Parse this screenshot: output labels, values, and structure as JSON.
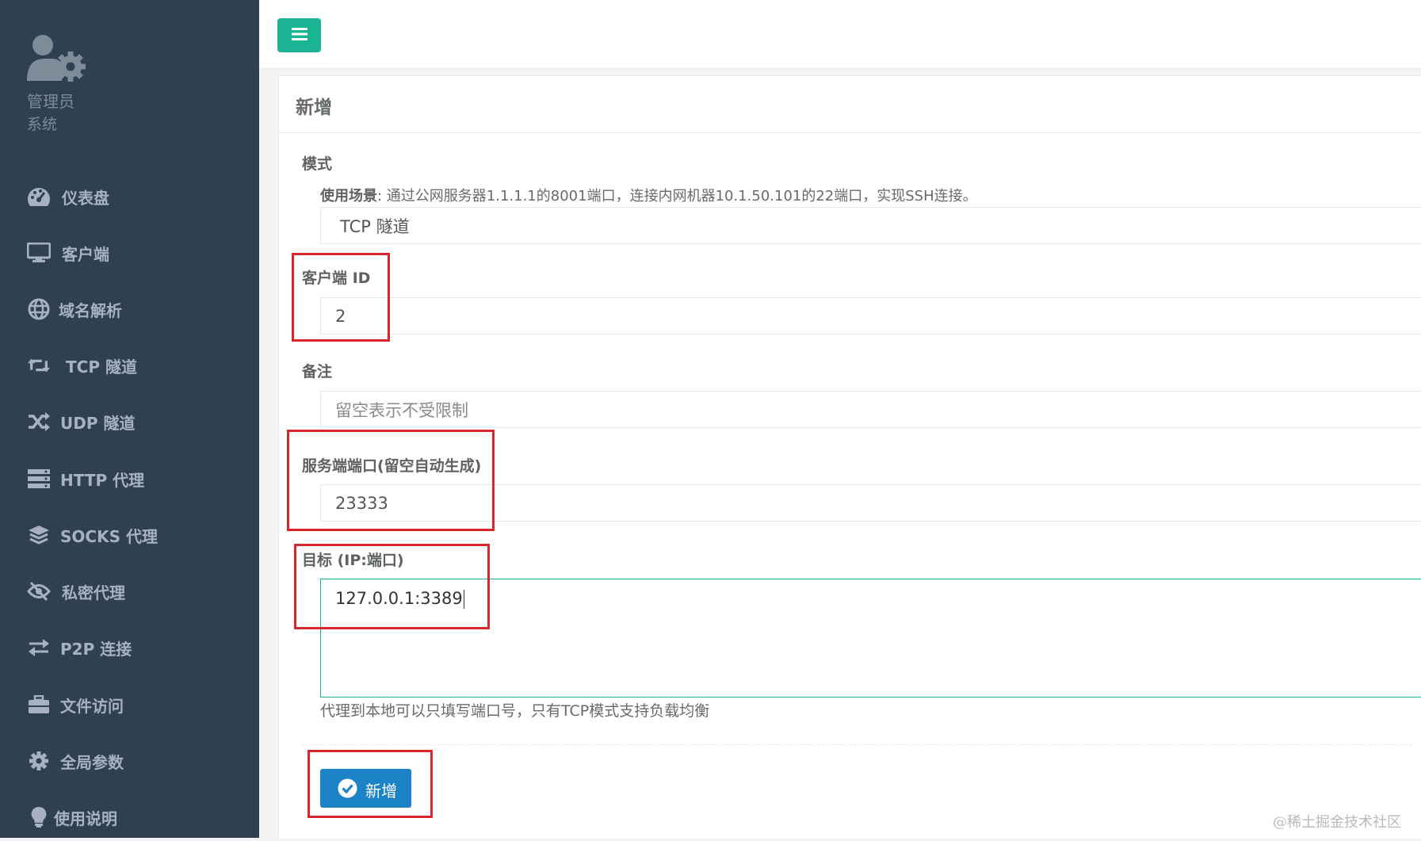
{
  "sidebar": {
    "profile": {
      "name": "管理员",
      "role": "系统"
    },
    "items": [
      {
        "label": "仪表盘",
        "icon": "dashboard-icon"
      },
      {
        "label": "客户端",
        "icon": "desktop-icon"
      },
      {
        "label": "域名解析",
        "icon": "globe-icon"
      },
      {
        "label": "TCP 隧道",
        "icon": "retweet-icon"
      },
      {
        "label": "UDP 隧道",
        "icon": "random-icon"
      },
      {
        "label": "HTTP 代理",
        "icon": "server-icon"
      },
      {
        "label": "SOCKS 代理",
        "icon": "layers-icon"
      },
      {
        "label": "私密代理",
        "icon": "eye-slash-icon"
      },
      {
        "label": "P2P 连接",
        "icon": "exchange-icon"
      },
      {
        "label": "文件访问",
        "icon": "briefcase-icon"
      },
      {
        "label": "全局参数",
        "icon": "gear-icon"
      },
      {
        "label": "使用说明",
        "icon": "lightbulb-icon"
      }
    ]
  },
  "header": {
    "menu_icon": "bars-icon"
  },
  "panel": {
    "title": "新增",
    "mode": {
      "label": "模式",
      "hint_title": "使用场景",
      "hint_text": ": 通过公网服务器1.1.1.1的8001端口，连接内网机器10.1.50.101的22端口，实现SSH连接。",
      "value": "TCP 隧道"
    },
    "client_id": {
      "label": "客户端 ID",
      "value": "2"
    },
    "remark": {
      "label": "备注",
      "placeholder": "留空表示不受限制"
    },
    "server_port": {
      "label": "服务端端口(留空自动生成)",
      "value": "23333"
    },
    "target": {
      "label": "目标 (IP:端口)",
      "value": "127.0.0.1:3389",
      "help": "代理到本地可以只填写端口号，只有TCP模式支持负载均衡"
    },
    "submit_label": "新增"
  },
  "watermark": "@稀土掘金技术社区",
  "colors": {
    "sidebar": "#2f4050",
    "primary": "#1ab394",
    "submit": "#1c84c6",
    "annotation": "#d9252e"
  }
}
